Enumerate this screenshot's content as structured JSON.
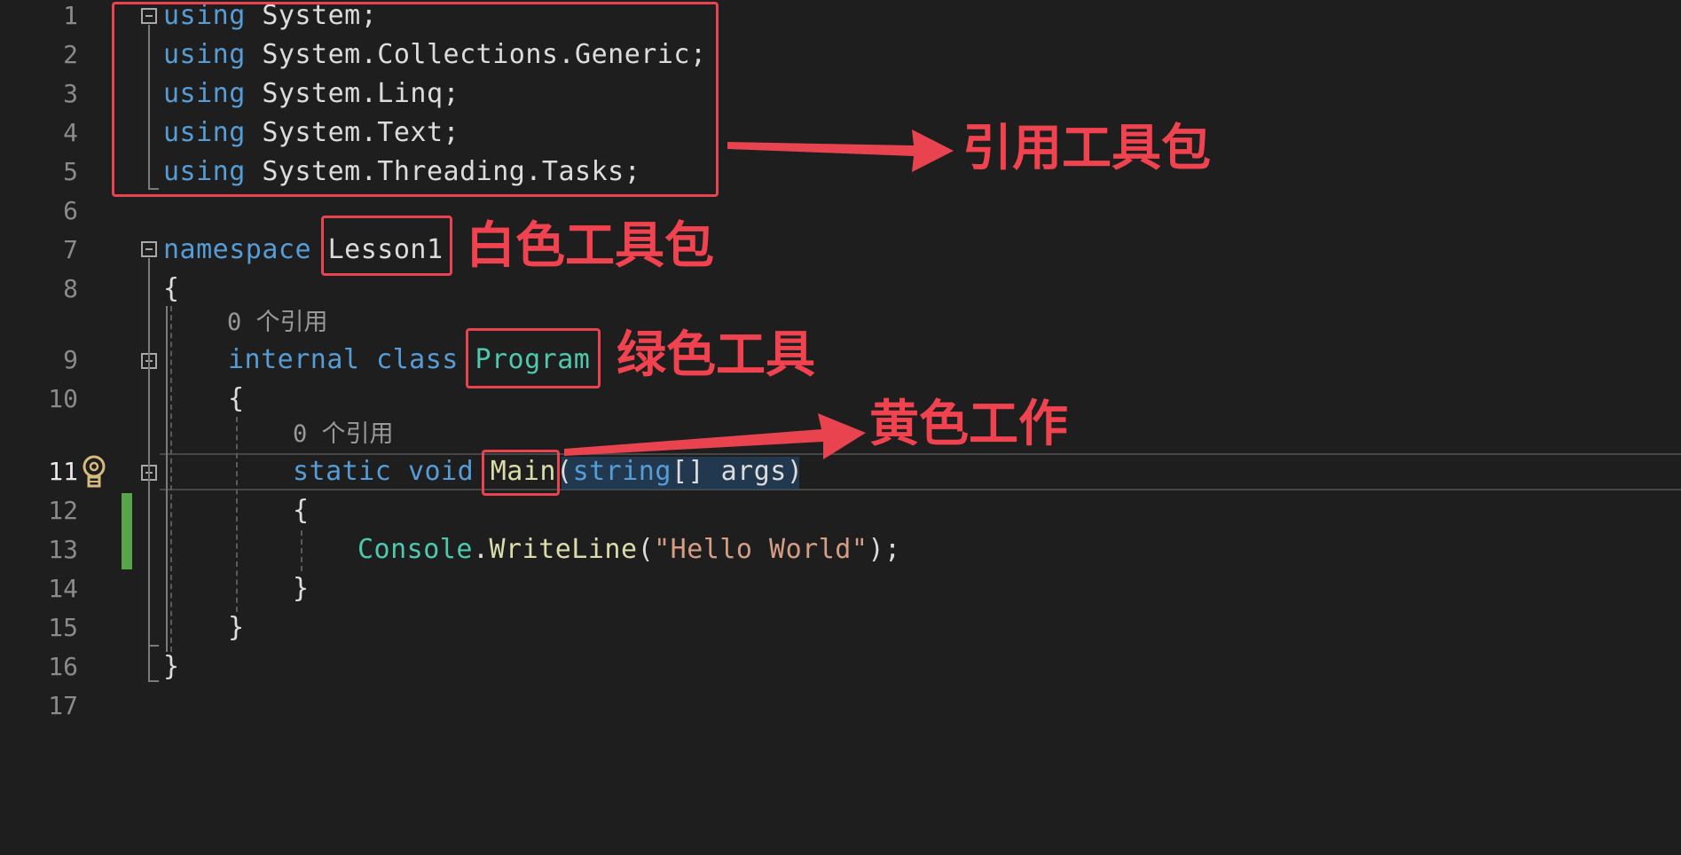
{
  "editor": {
    "line_numbers": [
      "1",
      "2",
      "3",
      "4",
      "5",
      "6",
      "7",
      "8",
      "9",
      "10",
      "11",
      "12",
      "13",
      "14",
      "15",
      "16",
      "17"
    ],
    "active_line": "11",
    "lines": {
      "l1": [
        {
          "t": "using",
          "c": "kw"
        },
        {
          "t": " System;",
          "c": "id"
        }
      ],
      "l2": [
        {
          "t": "using",
          "c": "kw"
        },
        {
          "t": " System.Collections.Generic;",
          "c": "id"
        }
      ],
      "l3": [
        {
          "t": "using",
          "c": "kw"
        },
        {
          "t": " System.Linq;",
          "c": "id"
        }
      ],
      "l4": [
        {
          "t": "using",
          "c": "kw"
        },
        {
          "t": " System.Text;",
          "c": "id"
        }
      ],
      "l5": [
        {
          "t": "using",
          "c": "kw"
        },
        {
          "t": " System.Threading.Tasks;",
          "c": "id"
        }
      ],
      "l7": [
        {
          "t": "namespace",
          "c": "kw"
        },
        {
          "t": " ",
          "c": "id"
        },
        {
          "t": "Lesson1",
          "c": "id"
        }
      ],
      "l8": [
        {
          "t": "{",
          "c": "punct"
        }
      ],
      "l9": [
        {
          "t": "internal",
          "c": "kw"
        },
        {
          "t": " ",
          "c": "id"
        },
        {
          "t": "class",
          "c": "kw"
        },
        {
          "t": " ",
          "c": "id"
        },
        {
          "t": "Program",
          "c": "cls"
        }
      ],
      "l10": [
        {
          "t": "{",
          "c": "punct"
        }
      ],
      "l11": [
        {
          "t": "static",
          "c": "kw"
        },
        {
          "t": " ",
          "c": "id"
        },
        {
          "t": "void",
          "c": "kw"
        },
        {
          "t": " ",
          "c": "id"
        },
        {
          "t": "Main",
          "c": "fn"
        },
        {
          "t": "(",
          "c": "punct"
        },
        {
          "t": "string",
          "c": "kw"
        },
        {
          "t": "[] ",
          "c": "punct"
        },
        {
          "t": "args",
          "c": "id"
        },
        {
          "t": ")",
          "c": "punct"
        }
      ],
      "l12": [
        {
          "t": "{",
          "c": "punct"
        }
      ],
      "l13": [
        {
          "t": "Console",
          "c": "cls"
        },
        {
          "t": ".",
          "c": "punct"
        },
        {
          "t": "WriteLine",
          "c": "fn"
        },
        {
          "t": "(",
          "c": "punct"
        },
        {
          "t": "\"Hello World\"",
          "c": "str"
        },
        {
          "t": ");",
          "c": "punct"
        }
      ],
      "l14": [
        {
          "t": "}",
          "c": "punct"
        }
      ],
      "l15": [
        {
          "t": "}",
          "c": "punct"
        }
      ],
      "l16": [
        {
          "t": "}",
          "c": "punct"
        }
      ]
    },
    "codelens_class": "0 个引用",
    "codelens_method": "0 个引用"
  },
  "annotations": {
    "usings_label": "引用工具包",
    "namespace_label": "白色工具包",
    "class_label": "绿色工具",
    "method_label": "黄色工作",
    "color": "#e8434f"
  }
}
